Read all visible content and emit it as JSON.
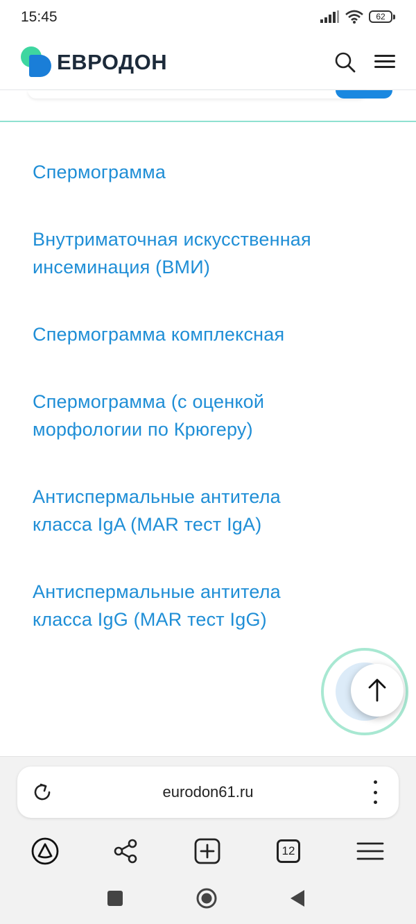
{
  "status_bar": {
    "time": "15:45",
    "battery": "62",
    "icons": [
      "signal-icon",
      "wifi-icon",
      "battery-icon"
    ]
  },
  "header": {
    "logo_text": "ЕВРОДОН",
    "icons": [
      "search-icon",
      "menu-icon"
    ]
  },
  "colors": {
    "link": "#1f8ed6",
    "brand_blue": "#1a7ed8",
    "brand_green": "#3ed6a0",
    "divider": "#8ee0d0"
  },
  "links": [
    {
      "line1": "Спермограмма",
      "line2": ""
    },
    {
      "line1": "Внутриматочная искусственная",
      "line2": "инсеминация (ВМИ)"
    },
    {
      "line1": "Спермограмма комплексная",
      "line2": ""
    },
    {
      "line1": "Спермограмма (с оценкой",
      "line2": "морфологии по Крюгеру)"
    },
    {
      "line1": "Антиспермальные антитела",
      "line2": "класса IgA (MAR тест IgA)"
    },
    {
      "line1": "Антиспермальные антитела",
      "line2": "класса IgG (MAR тест IgG)"
    }
  ],
  "browser": {
    "url": "eurodon61.ru",
    "tabs_count": "12",
    "toolbar_icons": [
      "alice-icon",
      "share-icon",
      "new-tab-icon",
      "tabs-icon",
      "menu-icon"
    ]
  },
  "system_nav": [
    "recents-icon",
    "home-icon",
    "back-icon"
  ]
}
